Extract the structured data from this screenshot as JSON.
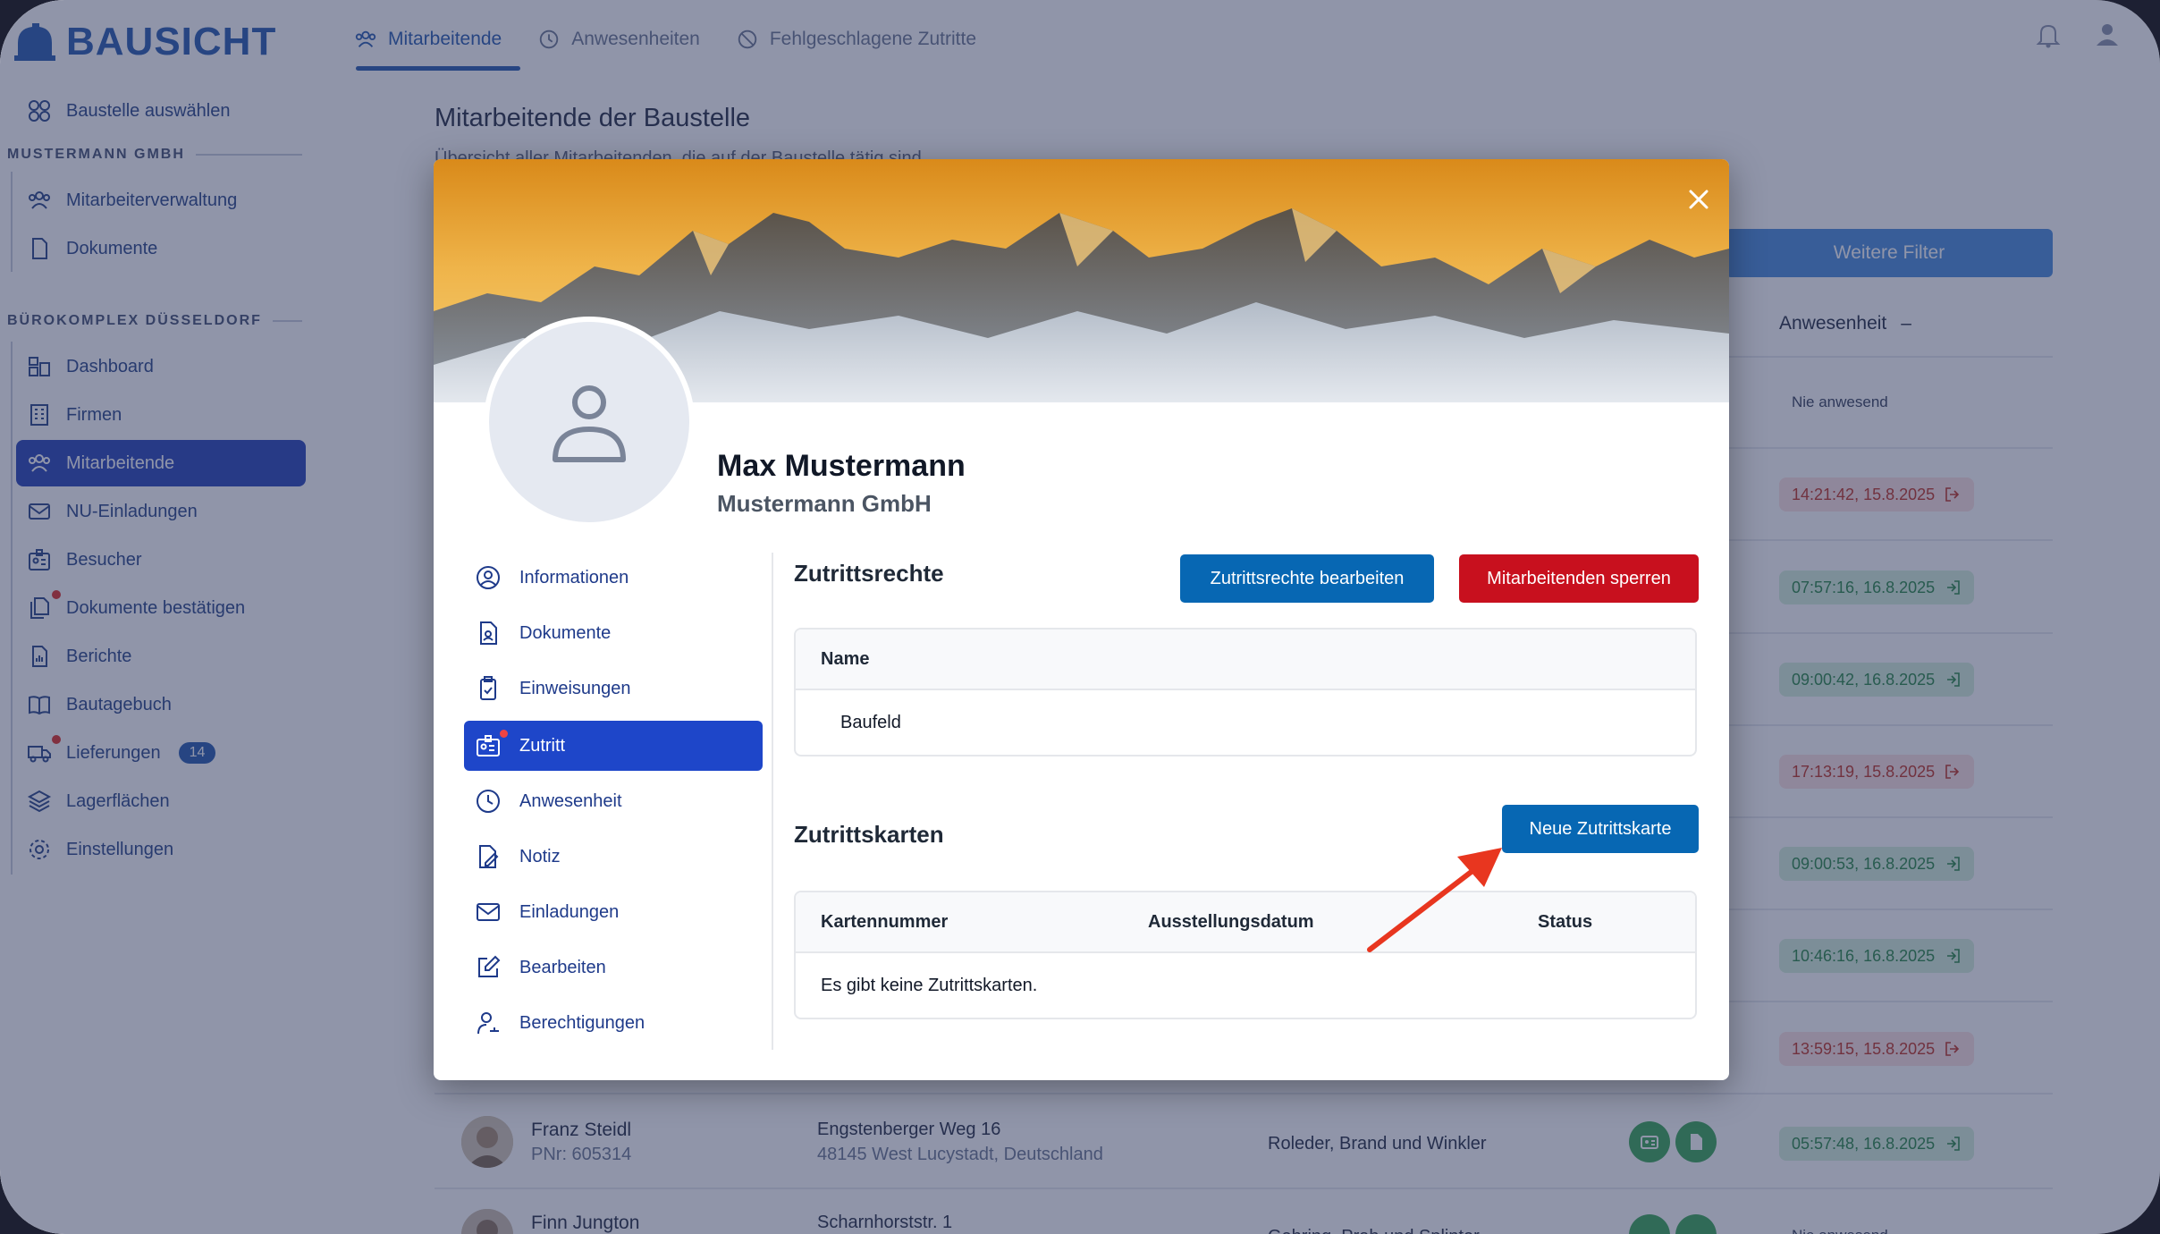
{
  "brand": {
    "name": "BAUSICHT"
  },
  "sidebar": {
    "select_site": "Baustelle auswählen",
    "section1": "MUSTERMANN GMBH",
    "section1_items": [
      "Mitarbeiterverwaltung",
      "Dokumente"
    ],
    "section2": "BÜROKOMPLEX DÜSSELDORF",
    "items": [
      "Dashboard",
      "Firmen",
      "Mitarbeitende",
      "NU-Einladungen",
      "Besucher",
      "Dokumente bestätigen",
      "Berichte",
      "Bautagebuch",
      "Lieferungen",
      "Lagerflächen",
      "Einstellungen"
    ],
    "deliveries_badge": "14"
  },
  "topnav": {
    "tabs": [
      "Mitarbeitende",
      "Anwesenheiten",
      "Fehlgeschlagene Zutritte"
    ]
  },
  "page": {
    "title": "Mitarbeitende der Baustelle",
    "subtitle": "Übersicht aller Mitarbeitenden, die auf der Baustelle tätig sind.",
    "filter_button": "Weitere Filter",
    "attendance_header": "Anwesenheit",
    "attendance_sort": "–",
    "attendance": [
      "Nie anwesend",
      "14:21:42, 15.8.2025",
      "07:57:16, 16.8.2025",
      "09:00:42, 16.8.2025",
      "17:13:19, 15.8.2025",
      "09:00:53, 16.8.2025",
      "10:46:16, 16.8.2025",
      "13:59:15, 15.8.2025",
      "05:57:48, 16.8.2025",
      "Nie anwesend"
    ],
    "rows": [
      {
        "name": "Franz Steidl",
        "pnr": "PNr: 605314",
        "addr1": "Engstenberger Weg 16",
        "addr2": "48145 West Lucystadt, Deutschland",
        "firm": "Roleder, Brand und Winkler"
      },
      {
        "name": "Finn Jungton",
        "pnr": "",
        "addr1": "Scharnhorststr. 1",
        "addr2": "",
        "firm": "Gehring, Prah und Splinter"
      }
    ]
  },
  "modal": {
    "name": "Max Mustermann",
    "company": "Mustermann GmbH",
    "nav": [
      "Informationen",
      "Dokumente",
      "Einweisungen",
      "Zutritt",
      "Anwesenheit",
      "Notiz",
      "Einladungen",
      "Bearbeiten",
      "Berechtigungen"
    ],
    "rights": {
      "title": "Zutrittsrechte",
      "edit_button": "Zutrittsrechte bearbeiten",
      "block_button": "Mitarbeitenden sperren",
      "col_name": "Name",
      "row_value": "Baufeld"
    },
    "cards": {
      "title": "Zutrittskarten",
      "new_button": "Neue Zutrittskarte",
      "col_number": "Kartennummer",
      "col_date": "Ausstellungsdatum",
      "col_status": "Status",
      "empty": "Es gibt keine Zutrittskarten."
    }
  },
  "colors": {
    "primary": "#0767b3",
    "danger": "#c8101e",
    "active_nav": "#1e46c9",
    "annotation_arrow": "#e8361f"
  }
}
